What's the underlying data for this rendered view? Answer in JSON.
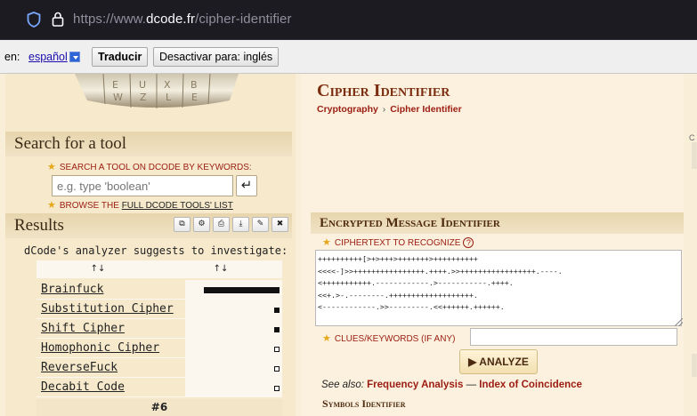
{
  "browser": {
    "url_prefix": "https://www.",
    "url_host": "dcode.fr",
    "url_path": "/cipher-identifier",
    "icons": [
      "shield-icon",
      "lock-icon"
    ]
  },
  "translate_bar": {
    "label": "en:",
    "language": "español",
    "translate_button": "Traducir",
    "disable_button": "Desactivar para: inglés"
  },
  "sidebar": {
    "search_heading": "Search for a tool",
    "search_hint": "SEARCH A TOOL ON DCODE BY KEYWORDS:",
    "search_placeholder": "e.g. type 'boolean'",
    "browse_prefix": "BROWSE THE",
    "browse_link": "FULL DCODE TOOLS' LIST",
    "results_heading": "Results",
    "result_tools": [
      "copy-icon",
      "settings-icon",
      "print-icon",
      "download-icon",
      "pin-icon",
      "close-icon"
    ],
    "analyzer_text": "dCode's analyzer suggests to investigate:",
    "sort_header_1": "↑↓",
    "sort_header_2": "↑↓",
    "results": [
      {
        "name": "Brainfuck",
        "score": 1.0
      },
      {
        "name": "Substitution Cipher",
        "score": 0.05
      },
      {
        "name": "Shift Cipher",
        "score": 0.05
      },
      {
        "name": "Homophonic Cipher",
        "score": 0.0
      },
      {
        "name": "ReverseFuck",
        "score": 0.0
      },
      {
        "name": "Decabit Code",
        "score": 0.0
      }
    ],
    "last_row": "#6"
  },
  "main": {
    "title": "Cipher Identifier",
    "breadcrumb_root": "Cryptography",
    "breadcrumb_sep": "›",
    "breadcrumb_current": "Cipher Identifier",
    "section_title": "Encrypted Message Identifier",
    "ciphertext_label": "CIPHERTEXT TO RECOGNIZE",
    "help_symbol": "?",
    "ciphertext": "++++++++++[>+>+++>+++++++>++++++++++\n<<<<-]>>++++++++++++++++.++++.>>+++++++++++++++++.----.\n<+++++++++++.------------.>-----------.++++.\n<<+.>-.--------.+++++++++++++++++++.\n<------------.>>---------.<<++++++.++++++.",
    "clues_label": "CLUES/KEYWORDS (IF ANY)",
    "analyze_button": "▶ ANALYZE",
    "see_also_label": "See also:",
    "see_also_link_1": "Frequency Analysis",
    "see_also_sep": "—",
    "see_also_link_2": "Index of Coincidence",
    "symbols_title": "Symbols Identifier"
  },
  "right_edge": {
    "letter": "C"
  },
  "colors": {
    "accent_red": "#9c1c12",
    "title_brown": "#7b2d0f",
    "page_bg": "#f9efd9"
  }
}
